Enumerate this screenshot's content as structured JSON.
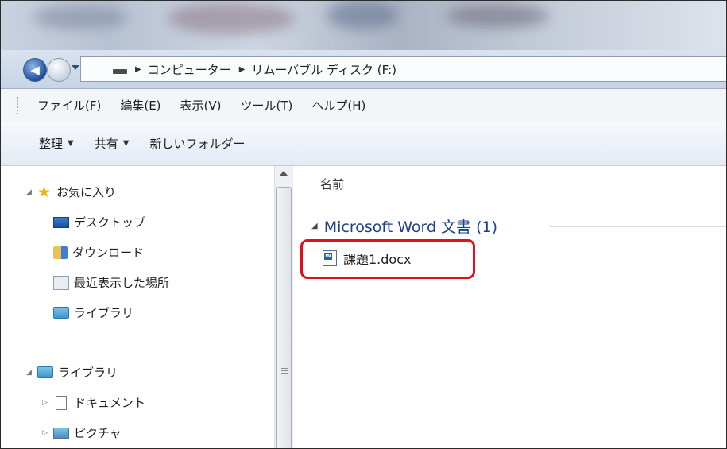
{
  "address": {
    "crumbs": [
      "コンピューター",
      "リムーバブル ディスク (F:)"
    ]
  },
  "menubar": {
    "items": [
      "ファイル(F)",
      "編集(E)",
      "表示(V)",
      "ツール(T)",
      "ヘルプ(H)"
    ]
  },
  "toolbar": {
    "organize": "整理",
    "share": "共有",
    "new_folder": "新しいフォルダー"
  },
  "nav": {
    "favorites": "お気に入り",
    "desktop": "デスクトップ",
    "downloads": "ダウンロード",
    "recent": "最近表示した場所",
    "libraries_fav": "ライブラリ",
    "libraries": "ライブラリ",
    "documents": "ドキュメント",
    "pictures": "ピクチャ"
  },
  "content": {
    "column_name": "名前",
    "group_label": "Microsoft Word 文書 (1)",
    "file_name": "課題1.docx"
  },
  "colors": {
    "highlight": "#e2101d",
    "group_text": "#1e3f8b"
  },
  "icons": {
    "word_badge": "W"
  }
}
